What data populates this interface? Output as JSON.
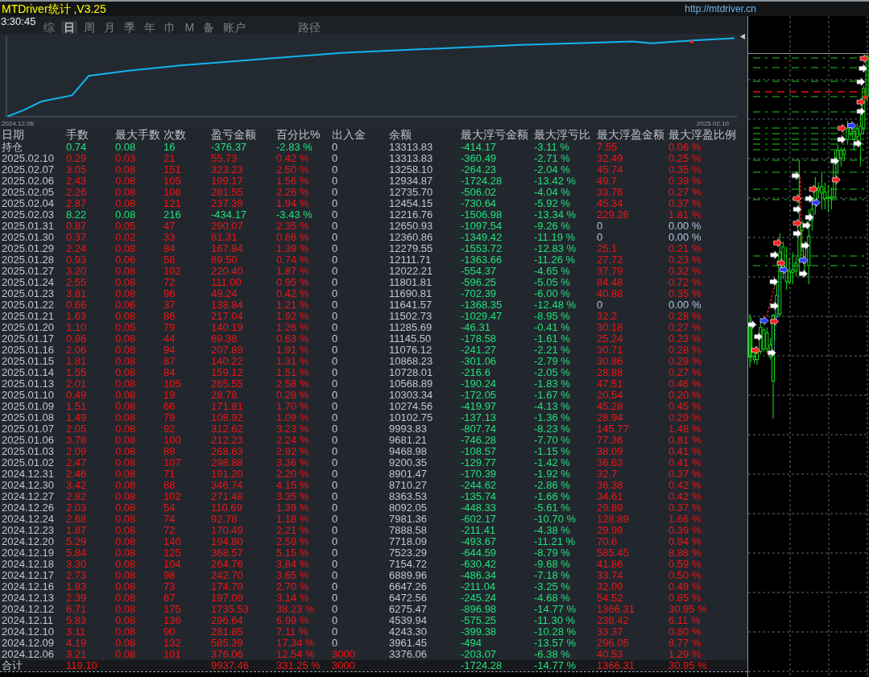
{
  "title_bar": {
    "title": "MTDriver统计 ,V3.25",
    "url": "http://mtdriver.cn"
  },
  "clock": "3:30:45",
  "tabs": [
    {
      "label": "综",
      "selected": false
    },
    {
      "label": "日",
      "selected": true
    },
    {
      "label": "周",
      "selected": false
    },
    {
      "label": "月",
      "selected": false
    },
    {
      "label": "季",
      "selected": false
    },
    {
      "label": "年",
      "selected": false
    },
    {
      "label": "巾",
      "selected": false
    },
    {
      "label": "M",
      "selected": false
    },
    {
      "label": "备",
      "selected": false
    },
    {
      "label": "账户",
      "selected": false
    },
    {
      "label": "路径",
      "selected": false
    }
  ],
  "equity_chart": {
    "start_label": "2024.12.06",
    "end_label": "2025.02.10"
  },
  "table": {
    "columns": [
      "日期",
      "手数",
      "最大手数",
      "次数",
      "盈亏金额",
      "百分比%",
      "出入金",
      "余额",
      "最大浮亏金额",
      "最大浮亏比",
      "最大浮盈金额",
      "最大浮盈比例"
    ],
    "rows": [
      {
        "cells": [
          "持仓",
          "0.74",
          "0.08",
          "16",
          "-376.37",
          "-2.83 %",
          "0",
          "13313.83",
          "-414.17",
          "-3.11 %",
          "7.55",
          "0.06 %"
        ],
        "kind": "loss",
        "has_deposit": false,
        "has_float_gain": true
      },
      {
        "cells": [
          "2025.02.10",
          "0.29",
          "0.03",
          "21",
          "55.73",
          "0.42 %",
          "0",
          "13313.83",
          "-360.49",
          "-2.71 %",
          "32.49",
          "0.25 %"
        ],
        "kind": "profit",
        "has_deposit": false,
        "has_float_gain": true
      },
      {
        "cells": [
          "2025.02.07",
          "3.05",
          "0.08",
          "151",
          "323.23",
          "2.50 %",
          "0",
          "13258.10",
          "-264.23",
          "-2.04 %",
          "45.74",
          "0.35 %"
        ],
        "kind": "profit",
        "has_deposit": false,
        "has_float_gain": true
      },
      {
        "cells": [
          "2025.02.06",
          "2.43",
          "0.08",
          "105",
          "199.17",
          "1.56 %",
          "0",
          "12934.87",
          "-1724.28",
          "-13.42 %",
          "49.7",
          "0.39 %"
        ],
        "kind": "profit",
        "has_deposit": false,
        "has_float_gain": true
      },
      {
        "cells": [
          "2025.02.05",
          "2.26",
          "0.08",
          "108",
          "281.55",
          "2.26 %",
          "0",
          "12735.70",
          "-506.02",
          "-4.04 %",
          "33.76",
          "0.27 %"
        ],
        "kind": "profit",
        "has_deposit": false,
        "has_float_gain": true
      },
      {
        "cells": [
          "2025.02.04",
          "2.87",
          "0.08",
          "121",
          "237.39",
          "1.94 %",
          "0",
          "12454.15",
          "-730.64",
          "-5.92 %",
          "45.34",
          "0.37 %"
        ],
        "kind": "profit",
        "has_deposit": false,
        "has_float_gain": true
      },
      {
        "cells": [
          "2025.02.03",
          "8.22",
          "0.08",
          "216",
          "-434.17",
          "-3.43 %",
          "0",
          "12216.76",
          "-1506.98",
          "-13.34 %",
          "229.26",
          "1.81 %"
        ],
        "kind": "loss",
        "has_deposit": false,
        "has_float_gain": true
      },
      {
        "cells": [
          "2025.01.31",
          "0.87",
          "0.05",
          "47",
          "290.07",
          "2.35 %",
          "0",
          "12650.93",
          "-1097.54",
          "-9.26 %",
          "0",
          "0.00 %"
        ],
        "kind": "profit",
        "has_deposit": false,
        "has_float_gain": false
      },
      {
        "cells": [
          "2025.01.30",
          "0.37",
          "0.02",
          "33",
          "81.31",
          "0.66 %",
          "0",
          "12360.86",
          "-1349.42",
          "-11.19 %",
          "0",
          "0.00 %"
        ],
        "kind": "profit",
        "has_deposit": false,
        "has_float_gain": false
      },
      {
        "cells": [
          "2025.01.29",
          "2.24",
          "0.08",
          "84",
          "167.84",
          "1.39 %",
          "0",
          "12279.55",
          "-1553.72",
          "-12.83 %",
          "25.1",
          "0.21 %"
        ],
        "kind": "profit",
        "has_deposit": false,
        "has_float_gain": true
      },
      {
        "cells": [
          "2025.01.28",
          "0.93",
          "0.06",
          "58",
          "89.50",
          "0.74 %",
          "0",
          "12111.71",
          "-1363.66",
          "-11.26 %",
          "27.72",
          "0.23 %"
        ],
        "kind": "profit",
        "has_deposit": false,
        "has_float_gain": true
      },
      {
        "cells": [
          "2025.01.27",
          "3.20",
          "0.08",
          "102",
          "220.40",
          "1.87 %",
          "0",
          "12022.21",
          "-554.37",
          "-4.65 %",
          "37.79",
          "0.32 %"
        ],
        "kind": "profit",
        "has_deposit": false,
        "has_float_gain": true
      },
      {
        "cells": [
          "2025.01.24",
          "2.55",
          "0.08",
          "72",
          "111.00",
          "0.95 %",
          "0",
          "11801.81",
          "-596.25",
          "-5.05 %",
          "84.48",
          "0.72 %"
        ],
        "kind": "profit",
        "has_deposit": false,
        "has_float_gain": true
      },
      {
        "cells": [
          "2025.01.23",
          "3.81",
          "0.08",
          "96",
          "49.24",
          "0.42 %",
          "0",
          "11690.81",
          "-702.39",
          "-6.00 %",
          "40.88",
          "0.35 %"
        ],
        "kind": "profit",
        "has_deposit": false,
        "has_float_gain": true
      },
      {
        "cells": [
          "2025.01.22",
          "0.66",
          "0.06",
          "37",
          "138.84",
          "1.21 %",
          "0",
          "11641.57",
          "-1368.35",
          "-12.48 %",
          "0",
          "0.00 %"
        ],
        "kind": "profit",
        "has_deposit": false,
        "has_float_gain": false
      },
      {
        "cells": [
          "2025.01.21",
          "1.63",
          "0.08",
          "86",
          "217.04",
          "1.92 %",
          "0",
          "11502.73",
          "-1029.47",
          "-8.95 %",
          "32.2",
          "0.28 %"
        ],
        "kind": "profit",
        "has_deposit": false,
        "has_float_gain": true
      },
      {
        "cells": [
          "2025.01.20",
          "1.10",
          "0.05",
          "79",
          "140.19",
          "1.26 %",
          "0",
          "11285.69",
          "-46.31",
          "-0.41 %",
          "30.18",
          "0.27 %"
        ],
        "kind": "profit",
        "has_deposit": false,
        "has_float_gain": true
      },
      {
        "cells": [
          "2025.01.17",
          "0.86",
          "0.08",
          "44",
          "69.38",
          "0.63 %",
          "0",
          "11145.50",
          "-178.58",
          "-1.61 %",
          "25.24",
          "0.23 %"
        ],
        "kind": "profit",
        "has_deposit": false,
        "has_float_gain": true
      },
      {
        "cells": [
          "2025.01.16",
          "2.06",
          "0.08",
          "94",
          "207.89",
          "1.91 %",
          "0",
          "11076.12",
          "-241.27",
          "-2.21 %",
          "30.71",
          "0.28 %"
        ],
        "kind": "profit",
        "has_deposit": false,
        "has_float_gain": true
      },
      {
        "cells": [
          "2025.01.15",
          "1.81",
          "0.08",
          "87",
          "140.22",
          "1.31 %",
          "0",
          "10868.23",
          "-301.06",
          "-2.79 %",
          "30.86",
          "0.29 %"
        ],
        "kind": "profit",
        "has_deposit": false,
        "has_float_gain": true
      },
      {
        "cells": [
          "2025.01.14",
          "1.55",
          "0.08",
          "84",
          "159.12",
          "1.51 %",
          "0",
          "10728.01",
          "-216.6",
          "-2.05 %",
          "28.88",
          "0.27 %"
        ],
        "kind": "profit",
        "has_deposit": false,
        "has_float_gain": true
      },
      {
        "cells": [
          "2025.01.13",
          "2.01",
          "0.08",
          "105",
          "265.55",
          "2.58 %",
          "0",
          "10568.89",
          "-190.24",
          "-1.83 %",
          "47.51",
          "0.46 %"
        ],
        "kind": "profit",
        "has_deposit": false,
        "has_float_gain": true
      },
      {
        "cells": [
          "2025.01.10",
          "0.49",
          "0.08",
          "19",
          "28.78",
          "0.28 %",
          "0",
          "10303.34",
          "-172.05",
          "-1.67 %",
          "20.54",
          "0.20 %"
        ],
        "kind": "profit",
        "has_deposit": false,
        "has_float_gain": true
      },
      {
        "cells": [
          "2025.01.09",
          "1.51",
          "0.08",
          "66",
          "171.81",
          "1.70 %",
          "0",
          "10274.56",
          "-419.97",
          "-4.13 %",
          "45.28",
          "0.45 %"
        ],
        "kind": "profit",
        "has_deposit": false,
        "has_float_gain": true
      },
      {
        "cells": [
          "2025.01.08",
          "1.49",
          "0.08",
          "79",
          "108.92",
          "1.09 %",
          "0",
          "10102.75",
          "-137.13",
          "-1.36 %",
          "28.94",
          "0.29 %"
        ],
        "kind": "profit",
        "has_deposit": false,
        "has_float_gain": true
      },
      {
        "cells": [
          "2025.01.07",
          "2.05",
          "0.08",
          "92",
          "312.62",
          "3.23 %",
          "0",
          "9993.83",
          "-807.74",
          "-8.23 %",
          "145.77",
          "1.48 %"
        ],
        "kind": "profit",
        "has_deposit": false,
        "has_float_gain": true
      },
      {
        "cells": [
          "2025.01.06",
          "3.78",
          "0.08",
          "100",
          "212.23",
          "2.24 %",
          "0",
          "9681.21",
          "-746.28",
          "-7.70 %",
          "77.36",
          "0.81 %"
        ],
        "kind": "profit",
        "has_deposit": false,
        "has_float_gain": true
      },
      {
        "cells": [
          "2025.01.03",
          "2.09",
          "0.08",
          "89",
          "268.63",
          "2.92 %",
          "0",
          "9468.98",
          "-108.57",
          "-1.15 %",
          "38.09",
          "0.41 %"
        ],
        "kind": "profit",
        "has_deposit": false,
        "has_float_gain": true
      },
      {
        "cells": [
          "2025.01.02",
          "2.47",
          "0.08",
          "107",
          "298.88",
          "3.36 %",
          "0",
          "9200.35",
          "-129.77",
          "-1.42 %",
          "36.63",
          "0.41 %"
        ],
        "kind": "profit",
        "has_deposit": false,
        "has_float_gain": true
      },
      {
        "cells": [
          "2024.12.31",
          "2.46",
          "0.08",
          "71",
          "191.20",
          "2.20 %",
          "0",
          "8901.47",
          "-170.39",
          "-1.92 %",
          "32.7",
          "0.37 %"
        ],
        "kind": "profit",
        "has_deposit": false,
        "has_float_gain": true
      },
      {
        "cells": [
          "2024.12.30",
          "3.42",
          "0.08",
          "88",
          "346.74",
          "4.15 %",
          "0",
          "8710.27",
          "-244.62",
          "-2.86 %",
          "36.38",
          "0.42 %"
        ],
        "kind": "profit",
        "has_deposit": false,
        "has_float_gain": true
      },
      {
        "cells": [
          "2024.12.27",
          "2.82",
          "0.08",
          "102",
          "271.48",
          "3.35 %",
          "0",
          "8363.53",
          "-135.74",
          "-1.66 %",
          "34.61",
          "0.42 %"
        ],
        "kind": "profit",
        "has_deposit": false,
        "has_float_gain": true
      },
      {
        "cells": [
          "2024.12.26",
          "2.03",
          "0.08",
          "54",
          "110.69",
          "1.39 %",
          "0",
          "8092.05",
          "-448.33",
          "-5.61 %",
          "29.89",
          "0.37 %"
        ],
        "kind": "profit",
        "has_deposit": false,
        "has_float_gain": true
      },
      {
        "cells": [
          "2024.12.24",
          "2.68",
          "0.08",
          "74",
          "92.78",
          "1.18 %",
          "0",
          "7981.36",
          "-602.17",
          "-10.70 %",
          "128.89",
          "1.66 %"
        ],
        "kind": "profit",
        "has_deposit": false,
        "has_float_gain": true
      },
      {
        "cells": [
          "2024.12.23",
          "1.87",
          "0.08",
          "72",
          "170.49",
          "2.21 %",
          "0",
          "7888.58",
          "-211.41",
          "-4.38 %",
          "29.99",
          "0.39 %"
        ],
        "kind": "profit",
        "has_deposit": false,
        "has_float_gain": true
      },
      {
        "cells": [
          "2024.12.20",
          "5.29",
          "0.08",
          "140",
          "194.80",
          "2.59 %",
          "0",
          "7718.09",
          "-493.67",
          "-11.21 %",
          "70.6",
          "0.94 %"
        ],
        "kind": "profit",
        "has_deposit": false,
        "has_float_gain": true
      },
      {
        "cells": [
          "2024.12.19",
          "5.84",
          "0.08",
          "125",
          "368.57",
          "5.15 %",
          "0",
          "7523.29",
          "-644.59",
          "-8.79 %",
          "585.45",
          "8.88 %"
        ],
        "kind": "profit",
        "has_deposit": false,
        "has_float_gain": true
      },
      {
        "cells": [
          "2024.12.18",
          "3.30",
          "0.08",
          "104",
          "264.76",
          "3.84 %",
          "0",
          "7154.72",
          "-630.42",
          "-9.68 %",
          "41.86",
          "0.59 %"
        ],
        "kind": "profit",
        "has_deposit": false,
        "has_float_gain": true
      },
      {
        "cells": [
          "2024.12.17",
          "2.73",
          "0.08",
          "98",
          "242.70",
          "3.65 %",
          "0",
          "6889.96",
          "-486.34",
          "-7.18 %",
          "33.74",
          "0.50 %"
        ],
        "kind": "profit",
        "has_deposit": false,
        "has_float_gain": true
      },
      {
        "cells": [
          "2024.12.16",
          "1.83",
          "0.08",
          "73",
          "174.70",
          "2.70 %",
          "0",
          "6647.26",
          "-211.04",
          "-3.25 %",
          "32.09",
          "0.49 %"
        ],
        "kind": "profit",
        "has_deposit": false,
        "has_float_gain": true
      },
      {
        "cells": [
          "2024.12.13",
          "2.39",
          "0.08",
          "67",
          "197.09",
          "3.14 %",
          "0",
          "6472.56",
          "-245.24",
          "-4.68 %",
          "54.52",
          "0.85 %"
        ],
        "kind": "profit",
        "has_deposit": false,
        "has_float_gain": true
      },
      {
        "cells": [
          "2024.12.12",
          "6.71",
          "0.08",
          "175",
          "1735.53",
          "38.23 %",
          "0",
          "6275.47",
          "-896.98",
          "-14.77 %",
          "1366.31",
          "30.95 %"
        ],
        "kind": "profit",
        "has_deposit": false,
        "has_float_gain": true
      },
      {
        "cells": [
          "2024.12.11",
          "5.83",
          "0.08",
          "136",
          "296.64",
          "6.99 %",
          "0",
          "4539.94",
          "-575.25",
          "-11.30 %",
          "238.42",
          "6.11 %"
        ],
        "kind": "profit",
        "has_deposit": false,
        "has_float_gain": true
      },
      {
        "cells": [
          "2024.12.10",
          "3.11",
          "0.08",
          "90",
          "281.85",
          "7.11 %",
          "0",
          "4243.30",
          "-399.38",
          "-10.28 %",
          "33.37",
          "0.80 %"
        ],
        "kind": "profit",
        "has_deposit": false,
        "has_float_gain": true
      },
      {
        "cells": [
          "2024.12.09",
          "4.19",
          "0.08",
          "132",
          "585.39",
          "17.34 %",
          "0",
          "3961.45",
          "-494",
          "-13.57 %",
          "296.05",
          "8.77 %"
        ],
        "kind": "profit",
        "has_deposit": false,
        "has_float_gain": true
      },
      {
        "cells": [
          "2024.12.06",
          "3.21",
          "0.08",
          "101",
          "376.06",
          "12.54 %",
          "3000",
          "3376.06",
          "-203.07",
          "-6.38 %",
          "40.53",
          "1.29 %"
        ],
        "kind": "profit",
        "has_deposit": true,
        "has_float_gain": true
      }
    ],
    "totals": {
      "label": "合计",
      "lots": "119.10",
      "pnl": "9937.46",
      "pct": "331.25 %",
      "deposit": "3000",
      "max_float_loss": "-1724.28",
      "max_float_loss_pct": "-14.77 %",
      "max_float_gain": "1366.31",
      "max_float_gain_pct": "30.95 %",
      "kind": "profit",
      "has_deposit": true,
      "has_float_gain": true
    }
  }
}
